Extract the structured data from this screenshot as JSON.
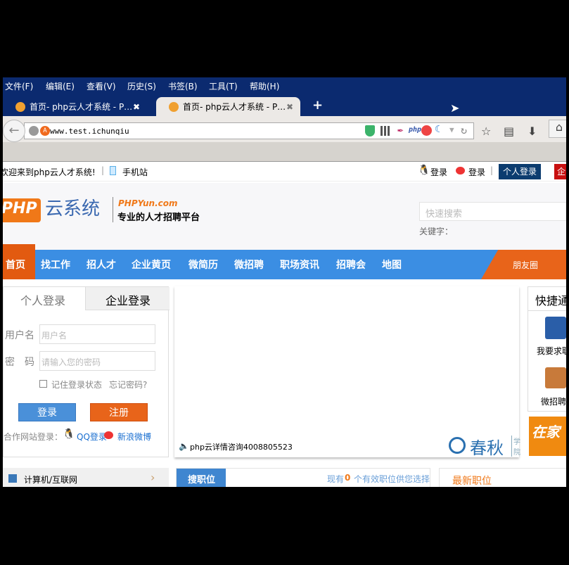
{
  "browser": {
    "menu": [
      "文件(F)",
      "编辑(E)",
      "查看(V)",
      "历史(S)",
      "书签(B)",
      "工具(T)",
      "帮助(H)"
    ],
    "tabs": [
      {
        "title": "首页- php云人才系统 - P…",
        "active": false
      },
      {
        "title": "首页- php云人才系统 - P…",
        "active": true
      }
    ],
    "new_tab": "+",
    "close": "✖",
    "url": "www.test.ichunqiu",
    "url_icon_letter": "A",
    "addon_php": "php"
  },
  "topbar": {
    "welcome": "欢迎来到php云人才系统!",
    "mobile": "手机站",
    "qq_login": "登录",
    "weibo_login": "登录",
    "personal_login": "个人登录",
    "company_login": "企"
  },
  "header": {
    "logo_php": "PHP",
    "logo_yun": "云系统",
    "domain": "PHPYun.com",
    "slogan": "专业的人才招聘平台",
    "search_placeholder": "快速搜索",
    "keyword_label": "关键字："
  },
  "nav": {
    "home": "首页",
    "items": [
      "找工作",
      "招人才",
      "企业黄页",
      "微简历",
      "微招聘",
      "职场资讯",
      "招聘会",
      "地图"
    ],
    "friends": "朋友圈"
  },
  "login": {
    "tabs": [
      "个人登录",
      "企业登录"
    ],
    "username_label": "用户名",
    "username_placeholder": "用户名",
    "password_label": "密　码",
    "password_placeholder": "请输入您的密码",
    "remember": "记住登录状态",
    "forgot": "忘记密码?",
    "login_btn": "登录",
    "register_btn": "注册",
    "partner_label": "合作网站登录：",
    "qq": "QQ登录",
    "weibo": "新浪微博"
  },
  "banner": {
    "notice": "php云详情咨询4008805523",
    "brand": "春秋",
    "brand_side": "学院"
  },
  "quick": {
    "title": "快捷通",
    "items": [
      "我要求职",
      "微招聘"
    ],
    "ad": "在家"
  },
  "bottom": {
    "category": "计算机/互联网",
    "search_jobs": "搜职位",
    "count_prefix": "现有",
    "count": "0",
    "count_suffix": "个有效职位供您选择",
    "latest": "最新职位"
  },
  "colors": {
    "menubar": "#0b2a6f",
    "nav": "#3b8ee3",
    "accent": "#e8641a",
    "login_blue": "#4a90d9"
  }
}
